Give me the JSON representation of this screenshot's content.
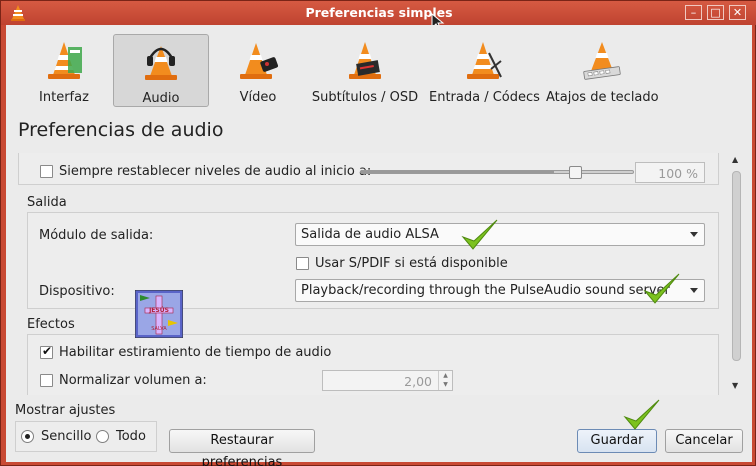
{
  "window": {
    "title": "Preferencias simples",
    "buttons": [
      "minimize-icon",
      "maximize-icon",
      "close-icon"
    ]
  },
  "categories": [
    {
      "label": "Interfaz",
      "icon": "vlc-cone-interface-icon"
    },
    {
      "label": "Audio",
      "icon": "vlc-cone-headphones-icon",
      "selected": true
    },
    {
      "label": "Vídeo",
      "icon": "vlc-cone-video-icon"
    },
    {
      "label": "Subtítulos / OSD",
      "icon": "vlc-cone-subtitles-icon"
    },
    {
      "label": "Entrada / Códecs",
      "icon": "vlc-cone-codecs-icon"
    },
    {
      "label": "Atajos de teclado",
      "icon": "vlc-cone-hotkeys-icon"
    }
  ],
  "page_title": "Preferencias de audio",
  "audio": {
    "reset_levels_label": "Siempre restablecer niveles de audio al inicio a:",
    "reset_levels_checked": false,
    "reset_level_value": "100 %",
    "reset_level_slider_fraction": 0.71
  },
  "output": {
    "group_title": "Salida",
    "module_label": "Módulo de salida:",
    "module_value": "Salida de audio ALSA",
    "spdif_label": "Usar S/PDIF si está disponible",
    "spdif_checked": false,
    "device_label": "Dispositivo:",
    "device_value": "Playback/recording through the PulseAudio sound server"
  },
  "effects": {
    "group_title": "Efectos",
    "time_stretch_label": "Habilitar estiramiento de tiempo de audio",
    "time_stretch_checked": true,
    "normalize_label": "Normalizar volumen a:",
    "normalize_checked": false,
    "normalize_value": "2,00"
  },
  "show_settings": {
    "title": "Mostrar ajustes",
    "options": [
      "Sencillo",
      "Todo"
    ],
    "selected": "Sencillo"
  },
  "buttons": {
    "reset": "Restaurar preferencias",
    "save": "Guardar",
    "cancel": "Cancelar"
  },
  "overlay": {
    "sticker_lines": [
      "JESÚS",
      "SALVA"
    ],
    "checkmark_color": "#7cc21f"
  },
  "colors": {
    "window_frame": "#c94a34",
    "background": "#ebebeb"
  }
}
